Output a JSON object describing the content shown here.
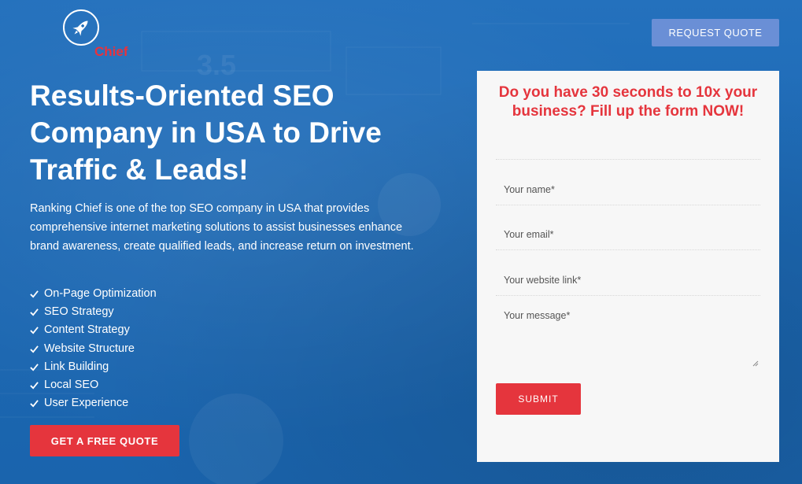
{
  "brand": {
    "logo_text": "Chief",
    "icon": "rocket-icon"
  },
  "header": {
    "request_quote_label": "REQUEST QUOTE"
  },
  "hero": {
    "headline": "Results-Oriented SEO Company in USA to Drive Traffic & Leads!",
    "intro": "Ranking Chief is one of the top SEO company in USA that provides comprehensive internet marketing solutions to assist businesses enhance brand awareness, create qualified leads, and increase return on investment.",
    "features": [
      "On-Page Optimization",
      "SEO Strategy",
      "Content Strategy",
      "Website Structure",
      "Link Building",
      "Local SEO",
      "User Experience"
    ],
    "cta_label": "GET A FREE QUOTE"
  },
  "form": {
    "heading": "Do you have 30 seconds to 10x your business? Fill up the form NOW!",
    "name_placeholder": "Your name*",
    "email_placeholder": "Your email*",
    "website_placeholder": "Your website link*",
    "message_placeholder": "Your message*",
    "submit_label": "SUBMIT"
  },
  "colors": {
    "accent_red": "#e5353d",
    "request_btn": "#6a8fd6",
    "background_blue": "#1f6db8",
    "form_bg": "#f7f7f7"
  }
}
